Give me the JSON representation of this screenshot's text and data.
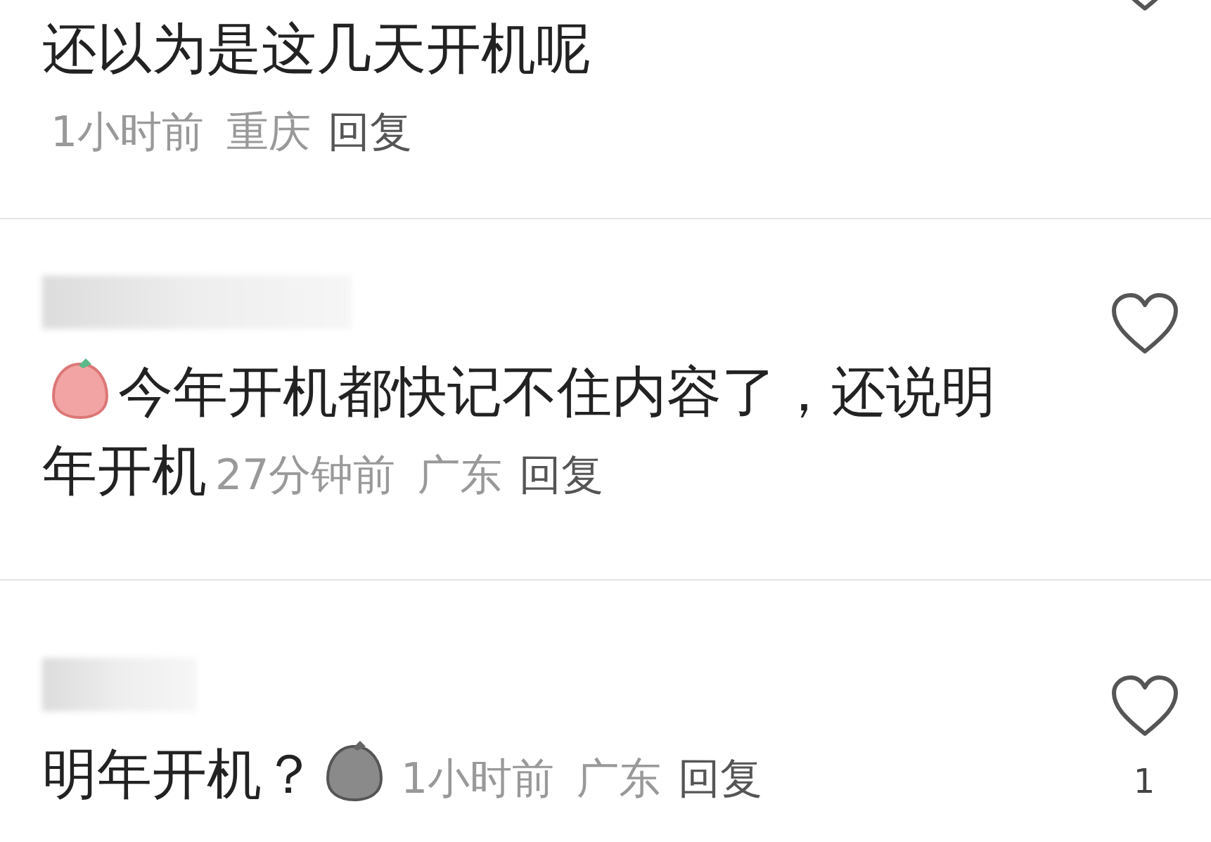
{
  "comments": [
    {
      "segments": [
        {
          "kind": "text",
          "text": "还以为是这几天开机呢"
        },
        {
          "kind": "break"
        }
      ],
      "time": "1小时前",
      "location": "重庆",
      "reply": "回复",
      "liked": false
    },
    {
      "author": {
        "kind": "blurred"
      },
      "segments": [
        {
          "kind": "sticker"
        },
        {
          "kind": "text",
          "text": "今年开机都快记不住内容了，还说明"
        },
        {
          "kind": "break"
        },
        {
          "kind": "text",
          "text": "年开机"
        }
      ],
      "time": "27分钟前",
      "location": "广东",
      "reply": "回复",
      "liked": false
    },
    {
      "author": {
        "kind": "blurred"
      },
      "segments": [
        {
          "kind": "text",
          "text": "明年开机？"
        },
        {
          "kind": "sticker"
        }
      ],
      "time": "1小时前",
      "location": "广东",
      "reply": "回复",
      "liked": false,
      "likes": "1"
    }
  ]
}
